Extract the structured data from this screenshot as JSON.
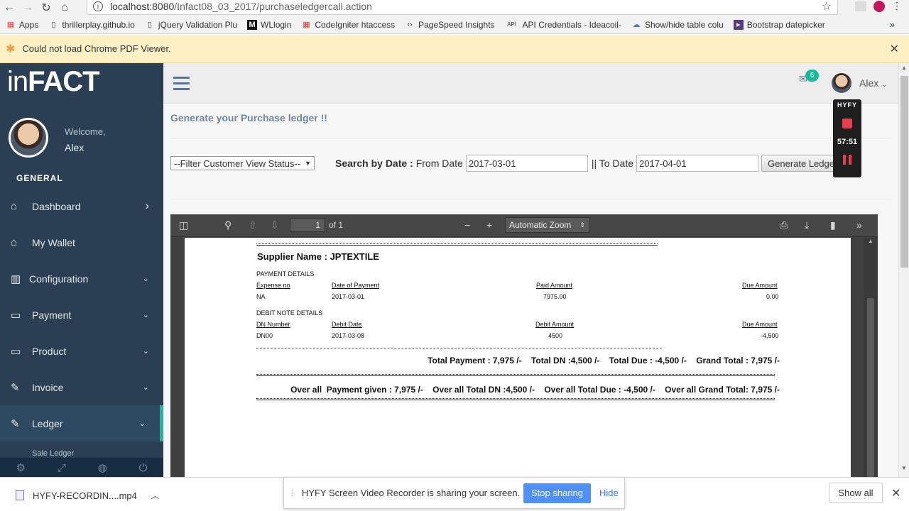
{
  "browser": {
    "url_host": "localhost:8080",
    "url_path": "/Infact08_03_2017/purchaseledgercall.action",
    "bookmarks": [
      {
        "icon": "apps-grid-icon",
        "label": "Apps"
      },
      {
        "icon": "page-icon",
        "label": "thrillerplay.github.io"
      },
      {
        "icon": "page-icon",
        "label": "jQuery Validation Plu"
      },
      {
        "icon": "m-icon",
        "label": "WLlogin"
      },
      {
        "icon": "grid-icon",
        "label": "CodeIgniter htaccess"
      },
      {
        "icon": "pagespeed-icon",
        "label": "PageSpeed Insights"
      },
      {
        "icon": "api-icon",
        "label": "API Credentials - Ideacoil-"
      },
      {
        "icon": "cloud-icon",
        "label": "Show/hide table colu"
      },
      {
        "icon": "bootstrap-icon",
        "label": "Bootstrap datepicker"
      }
    ],
    "infobar_text": "Could not load Chrome PDF Viewer."
  },
  "sidebar": {
    "logo_light": "in",
    "logo_bold": "FACT",
    "welcome": "Welcome,",
    "username": "Alex",
    "section_title": "GENERAL",
    "items": [
      {
        "label": "Dashboard",
        "icon": "home-icon",
        "chevron": "›"
      },
      {
        "label": "My Wallet",
        "icon": "home-icon",
        "chevron": ""
      },
      {
        "label": "Configuration",
        "icon": "bar-chart-icon",
        "chevron": "⌄"
      },
      {
        "label": "Payment",
        "icon": "desktop-icon",
        "chevron": "⌄"
      },
      {
        "label": "Product",
        "icon": "desktop-icon",
        "chevron": "⌄"
      },
      {
        "label": "Invoice",
        "icon": "edit-icon",
        "chevron": "⌄"
      },
      {
        "label": "Ledger",
        "icon": "edit-icon",
        "chevron": "⌄"
      }
    ],
    "submenu_peek": "Sale Ledger"
  },
  "topnav": {
    "mail_count": "6",
    "user": "Alex"
  },
  "content": {
    "heading": "Generate your Purchase ledger !!",
    "filter_select": "--Filter Customer View Status--",
    "search_label": "Search by Date :",
    "from_label": "From Date",
    "from_value": "2017-03-01",
    "to_label": "|| To Date",
    "to_value": "2017-04-01",
    "generate_button": "Generate Ledger"
  },
  "pdf": {
    "page_number": "1",
    "page_of": "of 1",
    "zoom": "Automatic Zoom",
    "supplier_name": "Supplier Name : JPTEXTILE",
    "payment_details_title": "PAYMENT DETAILS",
    "payment_headers": [
      "Expense no",
      "Date of Payment",
      "Paid Amount",
      "Due Amount"
    ],
    "payment_row": [
      "NA",
      "2017-03-01",
      "7975.00",
      "0.00"
    ],
    "debit_title": "DEBIT NOTE DETAILS",
    "debit_headers": [
      "DN Number",
      "Debit Date",
      "Debit Amount",
      "Due Amount"
    ],
    "debit_row": [
      "DN00",
      "2017-03-08",
      "4500",
      "-4,500"
    ],
    "totals_line": "Total Payment : 7,975 /-    Total DN :4,500 /-    Total Due : -4,500 /-    Grand Total : 7,975 /-",
    "overall_line": "Over all  Payment given : 7,975 /-    Over all Total DN :4,500 /-    Over all Total Due : -4,500 /-    Over all Grand Total: 7,975 /-"
  },
  "recorder": {
    "brand": "HYFY",
    "time": "57:51"
  },
  "share_bar": {
    "text": "HYFY Screen Video Recorder is sharing your screen.",
    "stop": "Stop sharing",
    "hide": "Hide"
  },
  "downloads": {
    "file": "HYFY-RECORDIN....mp4",
    "show_all": "Show all"
  }
}
